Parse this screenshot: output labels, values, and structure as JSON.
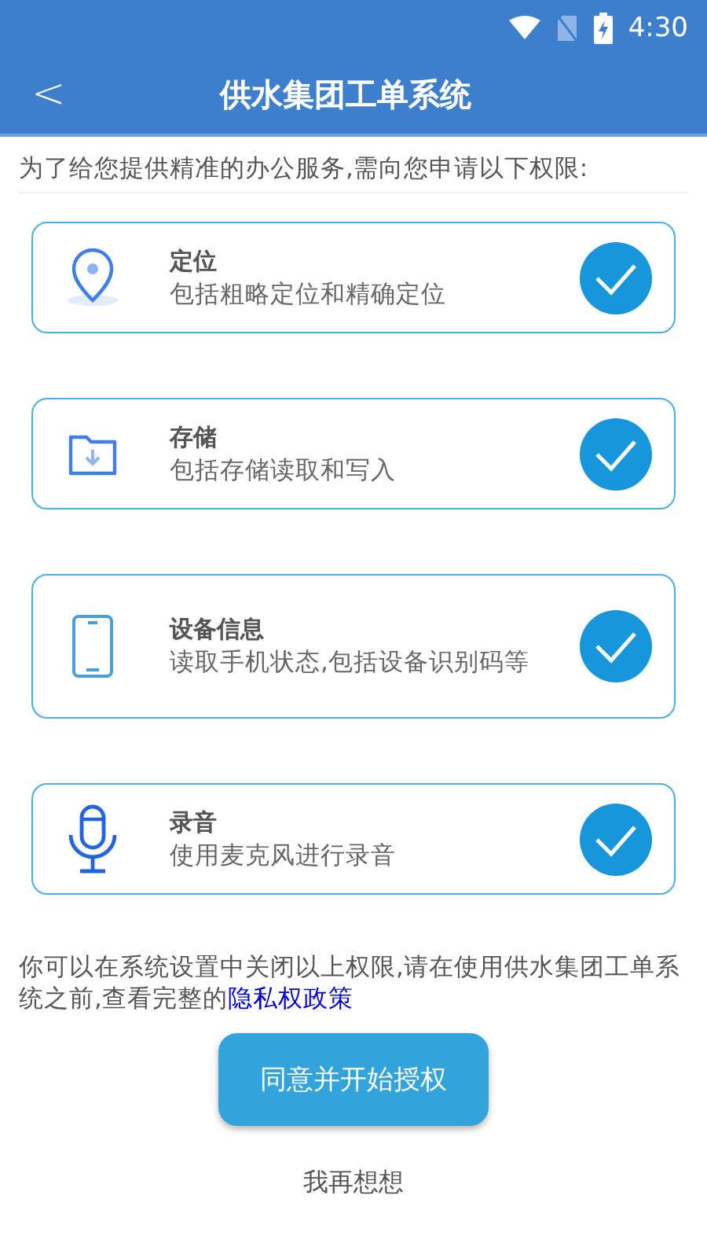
{
  "status_bar": {
    "time": "4:30"
  },
  "app_bar": {
    "back": "<",
    "title": "供水集团工单系统"
  },
  "intro": "为了给您提供精准的办公服务,需向您申请以下权限:",
  "permissions": [
    {
      "kind": "location",
      "title": "定位",
      "description": "包括粗略定位和精确定位",
      "checked": true
    },
    {
      "kind": "storage",
      "title": "存储",
      "description": "包括存储读取和写入",
      "checked": true
    },
    {
      "kind": "device",
      "title": "设备信息",
      "description": "读取手机状态,包括设备识别码等",
      "checked": true
    },
    {
      "kind": "microphone",
      "title": "录音",
      "description": "使用麦克风进行录音",
      "checked": true
    }
  ],
  "notice": {
    "text": "你可以在系统设置中关闭以上权限,请在使用供水集团工单系统之前,查看完整的",
    "link": "隐私权政策"
  },
  "agree_button": "同意并开始授权",
  "decline_link": "我再想想"
}
